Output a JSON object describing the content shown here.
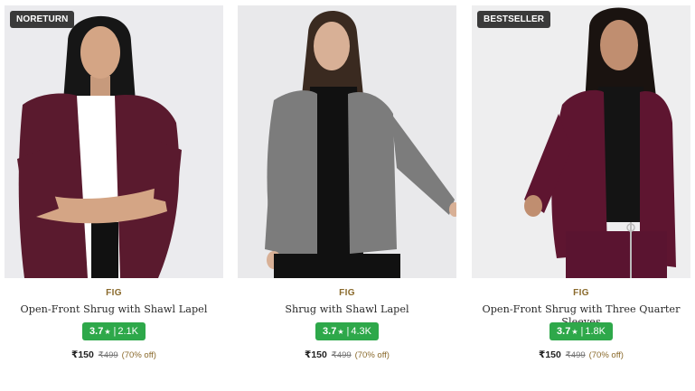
{
  "products": [
    {
      "badge": "NORETURN",
      "image_alt": "Woman in plum open-front shrug over white top",
      "brand": "FIG",
      "name": "Open-Front Shrug with Shawl Lapel",
      "rating": "3.7",
      "rating_star": "★",
      "reviews": "2.1K",
      "price": "₹150",
      "mrp": "₹499",
      "discount": "(70% off)",
      "garment_color": "#5a1a2e",
      "inner_color": "#ffffff"
    },
    {
      "badge": "",
      "image_alt": "Woman in grey shrug over black top",
      "brand": "FIG",
      "name": "Shrug with Shawl Lapel",
      "rating": "3.7",
      "rating_star": "★",
      "reviews": "4.3K",
      "price": "₹150",
      "mrp": "₹499",
      "discount": "(70% off)",
      "garment_color": "#7c7c7c",
      "inner_color": "#111111"
    },
    {
      "badge": "BESTSELLER",
      "image_alt": "Woman in plum shrug with three quarter sleeves",
      "brand": "FIG",
      "name": "Open-Front Shrug with Three Quarter Sleeves",
      "rating": "3.7",
      "rating_star": "★",
      "reviews": "1.8K",
      "price": "₹150",
      "mrp": "₹499",
      "discount": "(70% off)",
      "garment_color": "#5e1530",
      "inner_color": "#141414"
    }
  ],
  "colors": {
    "rating_bg": "#2ea84a",
    "brand_text": "#8a6a2c",
    "badge_bg": "#3a3a3a"
  }
}
